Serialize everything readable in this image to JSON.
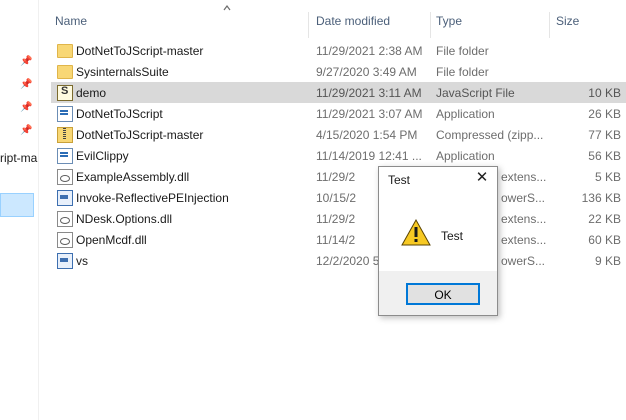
{
  "nav": {
    "truncated_item": "ript-ma"
  },
  "columns": {
    "name": "Name",
    "date": "Date modified",
    "type": "Type",
    "size": "Size"
  },
  "rows": [
    {
      "name": "DotNetToJScript-master",
      "date": "11/29/2021 2:38 AM",
      "type": "File folder",
      "size": "",
      "icon": "folder-icon"
    },
    {
      "name": "SysinternalsSuite",
      "date": "9/27/2020 3:49 AM",
      "type": "File folder",
      "size": "",
      "icon": "folder-icon"
    },
    {
      "name": "demo",
      "date": "11/29/2021 3:11 AM",
      "type": "JavaScript File",
      "size": "10 KB",
      "icon": "javascript-file-icon"
    },
    {
      "name": "DotNetToJScript",
      "date": "11/29/2021 3:07 AM",
      "type": "Application",
      "size": "26 KB",
      "icon": "application-icon"
    },
    {
      "name": "DotNetToJScript-master",
      "date": "4/15/2020 1:54 PM",
      "type": "Compressed (zipp...",
      "size": "77 KB",
      "icon": "zip-icon"
    },
    {
      "name": "EvilClippy",
      "date": "11/14/2019 12:41 ...",
      "type": "Application",
      "size": "56 KB",
      "icon": "application-icon"
    },
    {
      "name": "ExampleAssembly.dll",
      "date": "11/29/2",
      "type": "extens...",
      "size": "5 KB",
      "icon": "dll-icon"
    },
    {
      "name": "Invoke-ReflectivePEInjection",
      "date": "10/15/2",
      "type": "owerS...",
      "size": "136 KB",
      "icon": "powershell-icon"
    },
    {
      "name": "NDesk.Options.dll",
      "date": "11/29/2",
      "type": "extens...",
      "size": "22 KB",
      "icon": "dll-icon"
    },
    {
      "name": "OpenMcdf.dll",
      "date": "11/14/2",
      "type": "extens...",
      "size": "60 KB",
      "icon": "dll-icon"
    },
    {
      "name": "vs",
      "date": "12/2/2020 5",
      "type": "owerS...",
      "size": "9 KB",
      "icon": "powershell-icon"
    }
  ],
  "dialog": {
    "title": "Test",
    "message": "Test",
    "ok_label": "OK",
    "icon": "warning-icon",
    "close_icon": "close-icon"
  }
}
